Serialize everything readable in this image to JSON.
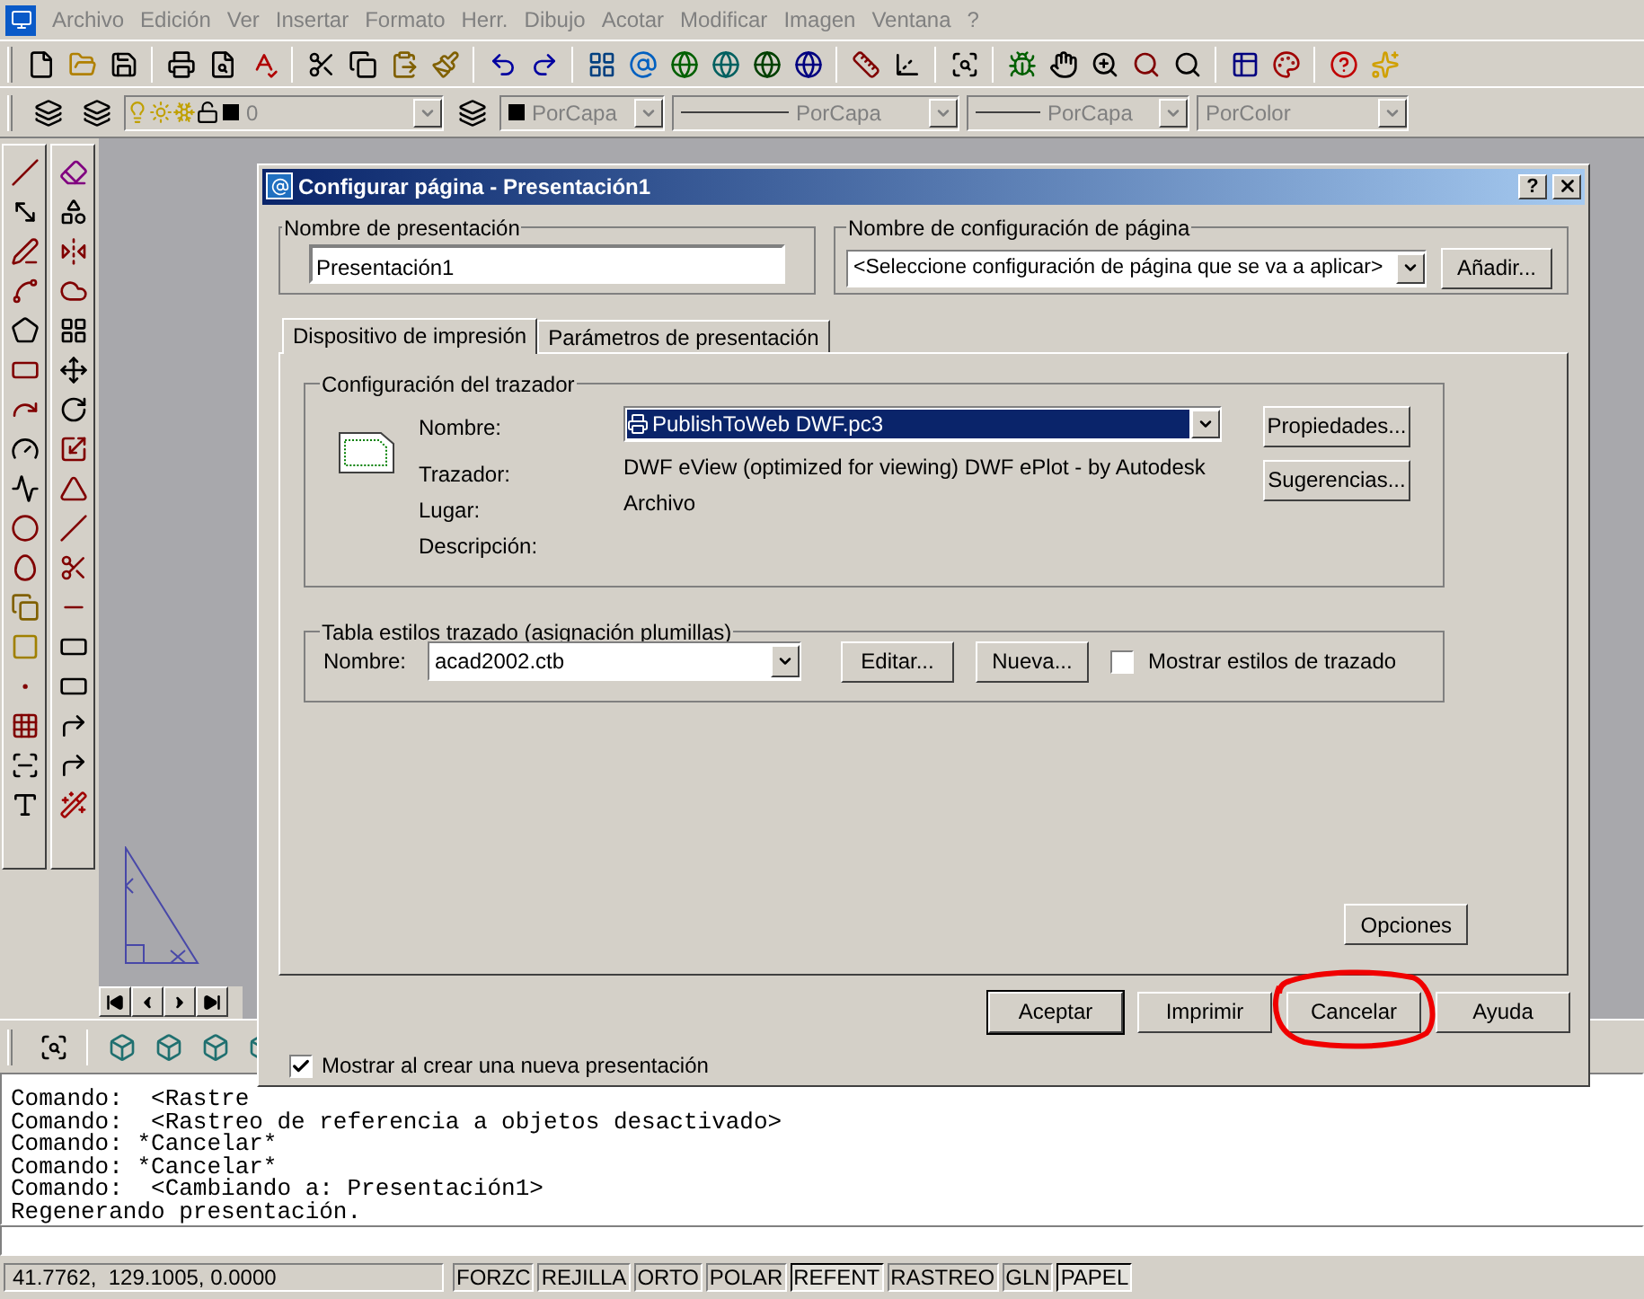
{
  "menu_bar": {
    "items": [
      "Archivo",
      "Edición",
      "Ver",
      "Insertar",
      "Formato",
      "Herr.",
      "Dibujo",
      "Acotar",
      "Modificar",
      "Imagen",
      "Ventana",
      "?"
    ]
  },
  "layer_toolbar": {
    "layer": "0",
    "color_setting": "PorCapa",
    "linetype": "PorCapa",
    "lineweight": "PorCapa",
    "plot_style": "PorColor"
  },
  "command_history": [
    "Comando:  <Rastre",
    "Comando:  <Rastreo de referencia a objetos desactivado>",
    "Comando: *Cancelar*",
    "Comando: *Cancelar*",
    "Comando:  <Cambiando a: Presentación1>",
    "Regenerando presentación."
  ],
  "status_bar": {
    "coordinates": "41.7762,  129.1005, 0.0000",
    "toggles": [
      {
        "label": "FORZC",
        "on": false
      },
      {
        "label": "REJILLA",
        "on": false
      },
      {
        "label": "ORTO",
        "on": false
      },
      {
        "label": "POLAR",
        "on": false
      },
      {
        "label": "REFENT",
        "on": true
      },
      {
        "label": "RASTREO",
        "on": false
      },
      {
        "label": "GLN",
        "on": false
      },
      {
        "label": "PAPEL",
        "on": true
      }
    ]
  },
  "dialog": {
    "title": "Configurar página - Presentación1",
    "help_button": "?",
    "layout_name": {
      "label": "Nombre de presentación",
      "value": "Presentación1"
    },
    "page_setup": {
      "label": "Nombre de configuración de página",
      "value": "<Seleccione configuración de página que se va a aplicar>",
      "button": "Añadir..."
    },
    "tabs": [
      {
        "label": "Dispositivo de impresión",
        "selected": true
      },
      {
        "label": "Parámetros de presentación",
        "selected": false
      }
    ],
    "plotter": {
      "title": "Configuración del trazador",
      "name_label": "Nombre:",
      "name_value": "PublishToWeb DWF.pc3",
      "plotter_label": "Trazador:",
      "plotter_value": "DWF eView (optimized for viewing) DWF ePlot - by Autodesk",
      "location_label": "Lugar:",
      "location_value": "Archivo",
      "description_label": "Descripción:",
      "buttons": [
        "Propiedades...",
        "Sugerencias..."
      ]
    },
    "plot_styles": {
      "title": "Tabla estilos trazado (asignación plumillas)",
      "name_label": "Nombre:",
      "value": "acad2002.ctb",
      "buttons": [
        "Editar...",
        "Nueva..."
      ],
      "show_styles": {
        "label": "Mostrar estilos de trazado",
        "checked": false
      }
    },
    "options_button": "Opciones",
    "footer_buttons": [
      {
        "label": "Aceptar",
        "default": true
      },
      {
        "label": "Imprimir",
        "default": false
      },
      {
        "label": "Cancelar",
        "default": false
      },
      {
        "label": "Ayuda",
        "default": false
      }
    ],
    "show_on_new": {
      "label": "Mostrar al crear una nueva presentación",
      "checked": true
    }
  }
}
